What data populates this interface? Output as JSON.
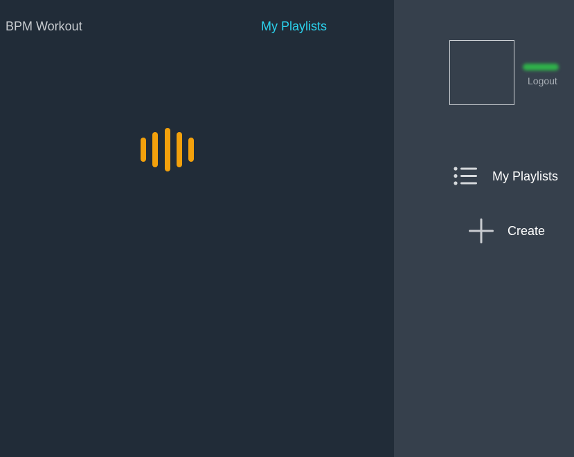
{
  "header": {
    "brand": "BPM Workout",
    "title": "My Playlists"
  },
  "loader": {
    "color": "#f3a10c",
    "icon": "audio-bars-loading-icon"
  },
  "sidebar": {
    "username_obscured": true,
    "logout_label": "Logout",
    "items": [
      {
        "label": "My Playlists",
        "icon": "list-icon"
      },
      {
        "label": "Create",
        "icon": "plus-icon"
      }
    ]
  },
  "colors": {
    "main_bg": "#212c38",
    "sidebar_bg": "#36404c",
    "accent": "#2bd3ee"
  }
}
